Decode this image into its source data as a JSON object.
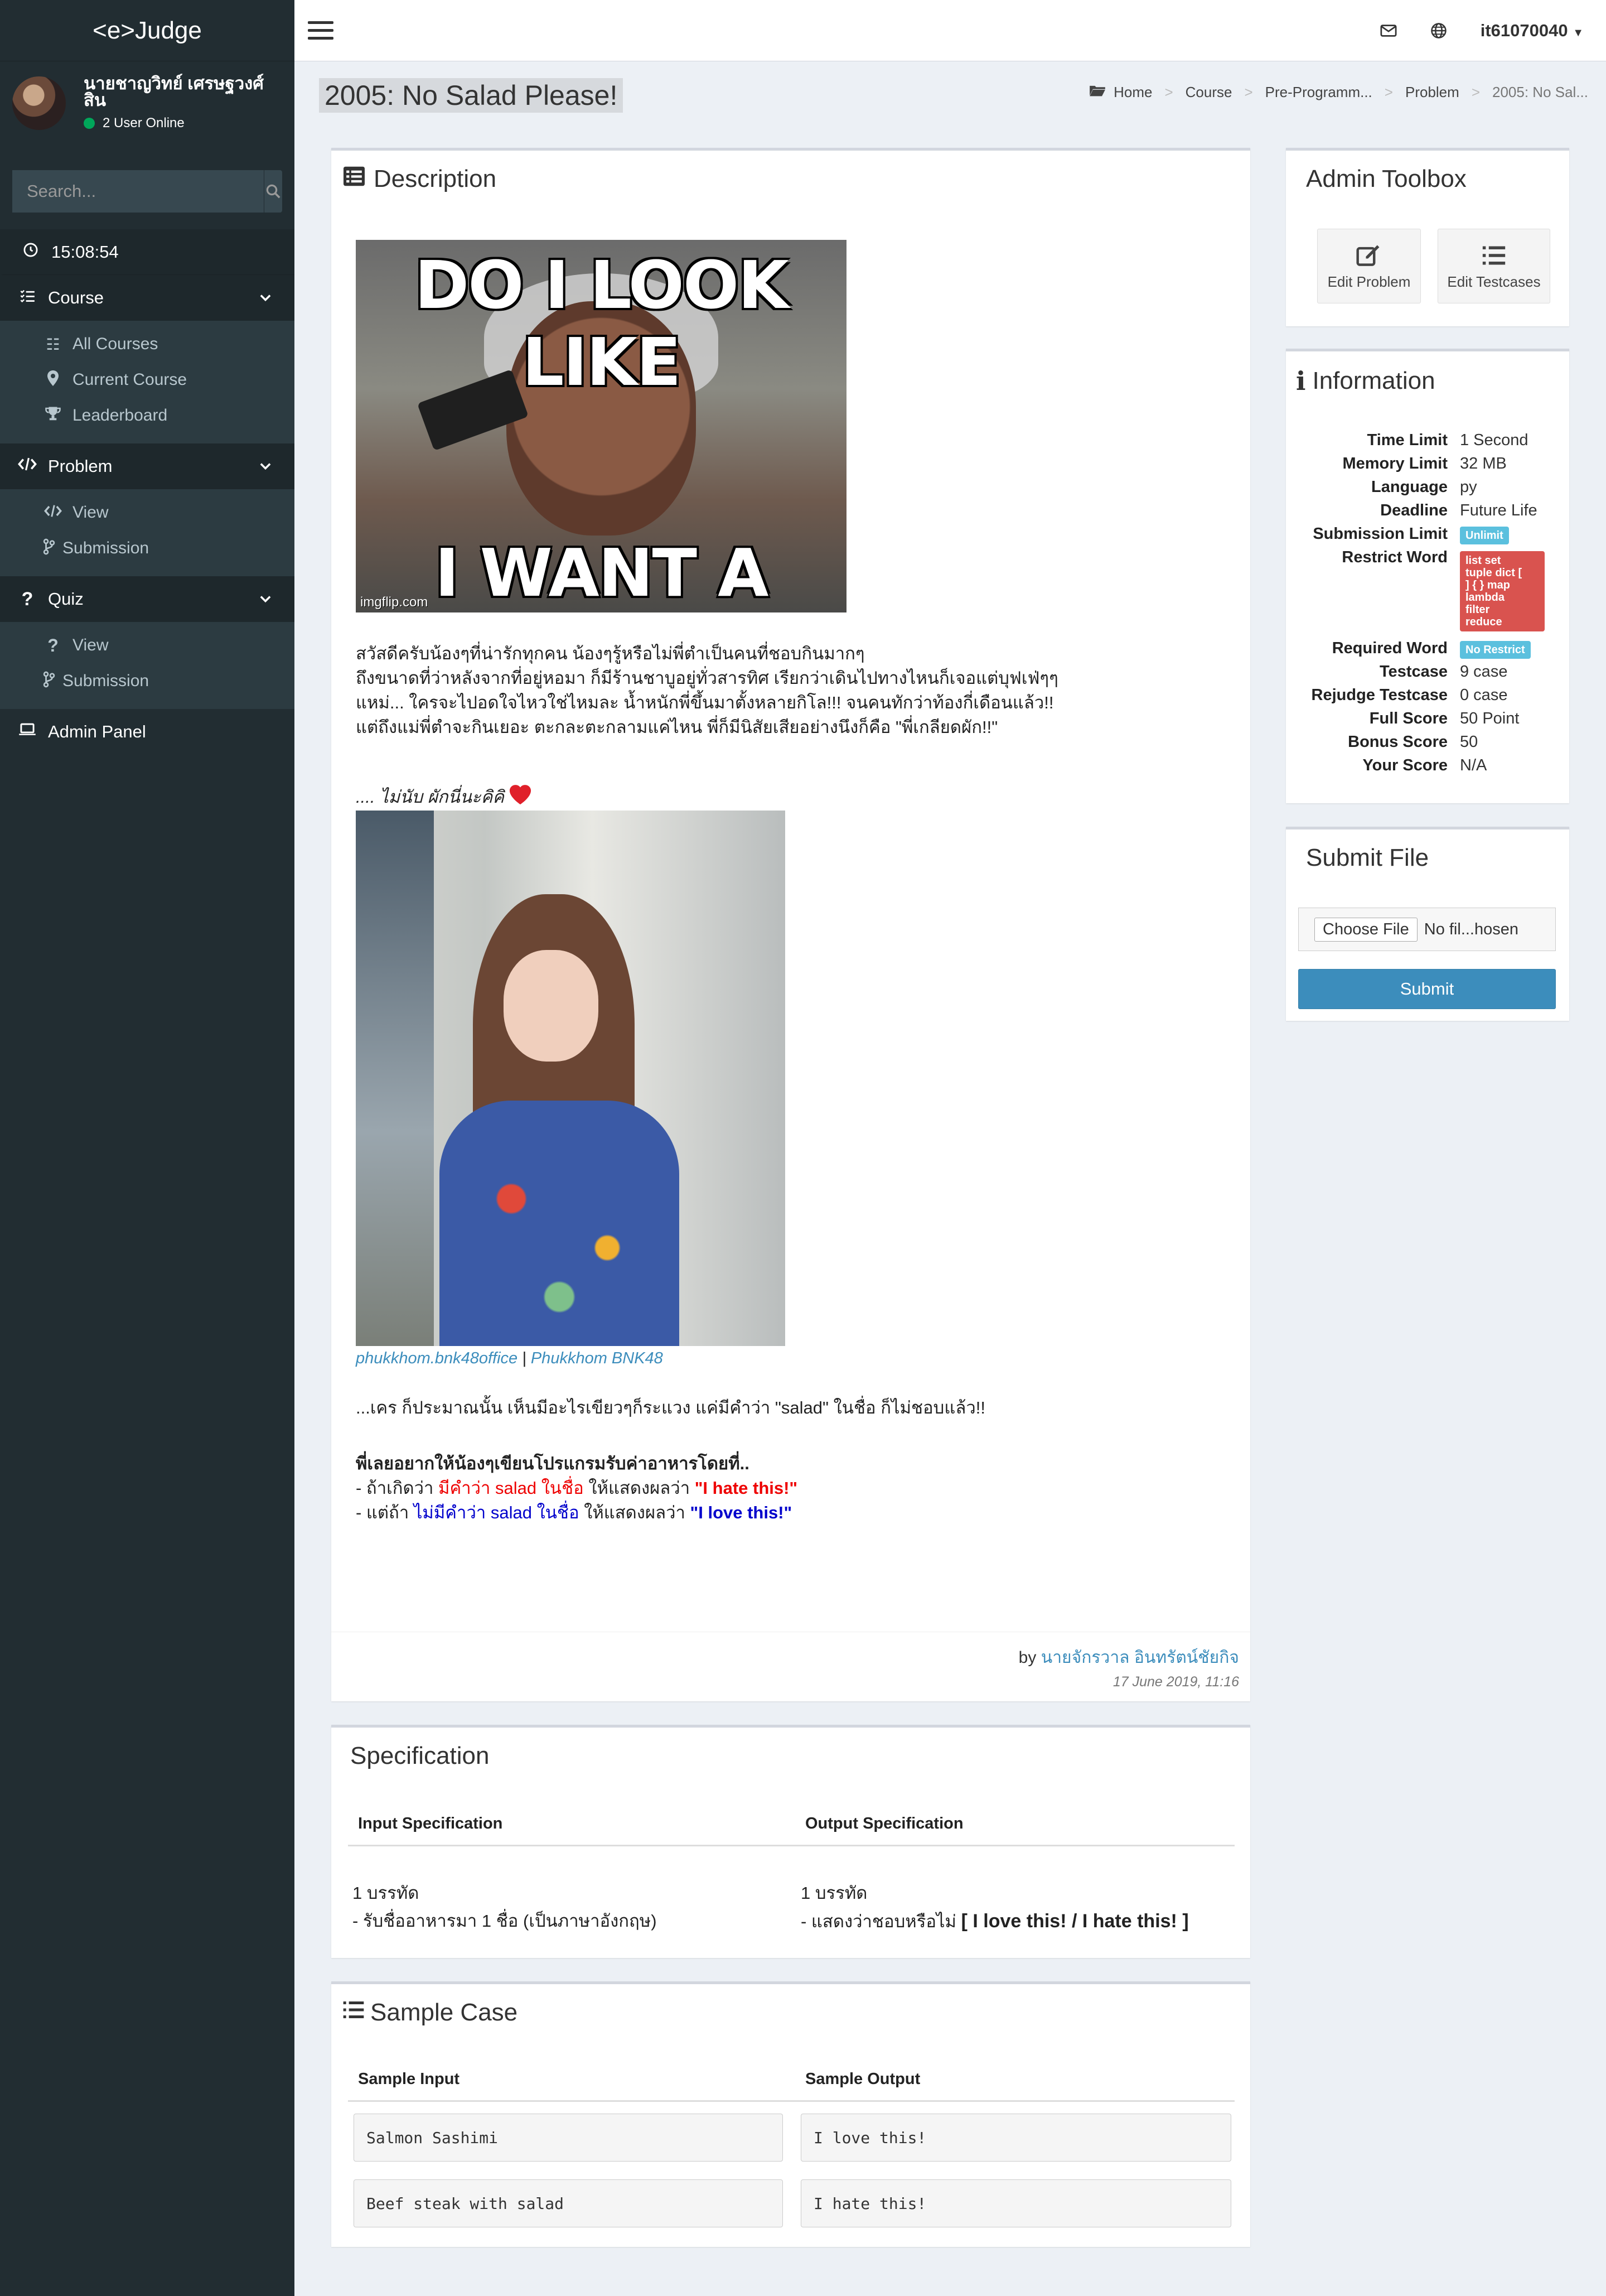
{
  "brand": "<e>Judge",
  "user": {
    "name": "นายชาญวิทย์ เศรษฐวงศ์สิน",
    "online": "2 User Online"
  },
  "search": {
    "placeholder": "Search..."
  },
  "clock": "15:08:54",
  "sidebar": {
    "course": {
      "label": "Course",
      "items": [
        "All Courses",
        "Current Course",
        "Leaderboard"
      ]
    },
    "problem": {
      "label": "Problem",
      "items": [
        "View",
        "Submission"
      ]
    },
    "quiz": {
      "label": "Quiz",
      "items": [
        "View",
        "Submission"
      ]
    },
    "admin": "Admin Panel"
  },
  "topbar": {
    "username": "it61070040"
  },
  "page_title": "2005: No Salad Please!",
  "breadcrumb": [
    "Home",
    "Course",
    "Pre-Programm...",
    "Problem",
    "2005: No Sal..."
  ],
  "description": {
    "title": "Description",
    "meme_top": "DO I LOOK LIKE",
    "meme_bottom": "I WANT A SALAD?",
    "meme_watermark": "imgflip.com",
    "para1": [
      "สวัสดีครับน้องๆที่น่ารักทุกคน น้องๆรู้หรือไม่พี่ตำเป็นคนที่ชอบกินมากๆ",
      "ถึงขนาดที่ว่าหลังจากที่อยู่หอมา ก็มีร้านชาบูอยู่ทั่วสารทิศ เรียกว่าเดินไปทางไหนก็เจอแต่บุฟเฟ่ๆๆ",
      "แหม่... ใครจะไปอดใจไหวใช่ไหมละ น้ำหนักพี่ขึ้นมาตั้งหลายกิโล!!! จนคนทักว่าท้องกี่เดือนแล้ว!!",
      "แต่ถึงแม่พี่ตำจะกินเยอะ ตะกละตะกลามแค่ไหน พี่ก็มีนิสัยเสียอย่างนึงก็คือ \"พี่เกลียดผัก!!\""
    ],
    "para2": ".... ไม่นับ ผักนี่นะคิคิ",
    "photo_credit_1": "phukkhom.bnk48office",
    "photo_credit_sep": " | ",
    "photo_credit_2": "Phukkhom BNK48",
    "para3": "...เคร ก็ประมาณนั้น เห็นมีอะไรเขียวๆก็ระแวง แค่มีคำว่า \"salad\" ในชื่อ ก็ไม่ชอบแล้ว!!",
    "para4_head": "พี่เลยอยากให้น้องๆเขียนโปรแกรมรับค่าอาหารโดยที่..",
    "rule1_a": " - ถ้าเกิดว่า ",
    "rule1_b": "มีคำว่า salad ในชื่อ",
    "rule1_c": " ให้แสดงผลว่า ",
    "rule1_d": "\"I hate this!\"",
    "rule2_a": " - แต่ถ้า ",
    "rule2_b": "ไม่มีคำว่า salad ในชื่อ",
    "rule2_c": " ให้แสดงผลว่า ",
    "rule2_d": "\"I love this!\"",
    "author_prefix": "by ",
    "author": "นายจักรวาล อินทรัตน์ชัยกิจ",
    "date": "17 June 2019, 11:16"
  },
  "specification": {
    "title": "Specification",
    "input_header": "Input Specification",
    "output_header": "Output Specification",
    "input_line1": "1 บรรทัด",
    "input_line2": " - รับชื่ออาหารมา 1 ชื่อ (เป็นภาษาอังกฤษ)",
    "output_line1": "1 บรรทัด",
    "output_line2": " - แสดงว่าชอบหรือไม่ ",
    "output_line2_bold": " [ I love this! / I hate this! ]"
  },
  "sample": {
    "title": "Sample Case",
    "input_header": "Sample Input",
    "output_header": "Sample Output",
    "rows": [
      {
        "input": "Salmon Sashimi",
        "output": "I love this!"
      },
      {
        "input": "Beef steak with salad",
        "output": "I hate this!"
      }
    ]
  },
  "admin_toolbox": {
    "title": "Admin Toolbox",
    "edit_problem": "Edit Problem",
    "edit_testcases": "Edit Testcases"
  },
  "information": {
    "title": "Information",
    "time_limit_k": "Time Limit",
    "time_limit_v": "1 Second",
    "memory_limit_k": "Memory Limit",
    "memory_limit_v": "32 MB",
    "language_k": "Language",
    "language_v": "py",
    "deadline_k": "Deadline",
    "deadline_v": "Future Life",
    "submission_limit_k": "Submission Limit",
    "submission_limit_v": "Unlimit",
    "restrict_word_k": "Restrict Word",
    "restrict_word_v": [
      "list set",
      "tuple dict [",
      "] { } map",
      "lambda",
      "filter",
      "reduce"
    ],
    "required_word_k": "Required Word",
    "required_word_v": "No Restrict",
    "testcase_k": "Testcase",
    "testcase_v": "9 case",
    "rejudge_k": "Rejudge Testcase",
    "rejudge_v": "0 case",
    "full_score_k": "Full Score",
    "full_score_v": "50 Point",
    "bonus_score_k": "Bonus Score",
    "bonus_score_v": "50",
    "your_score_k": "Your Score",
    "your_score_v": "N/A"
  },
  "submit_file": {
    "title": "Submit File",
    "choose_label": "Choose File",
    "file_status": "No fil...hosen",
    "submit_label": "Submit"
  },
  "colors": {
    "sidebar_bg": "#222d32",
    "link": "#3c8dbc",
    "label_info": "#5bc0de",
    "label_danger": "#d9534f",
    "submit": "#3c8dbc"
  }
}
